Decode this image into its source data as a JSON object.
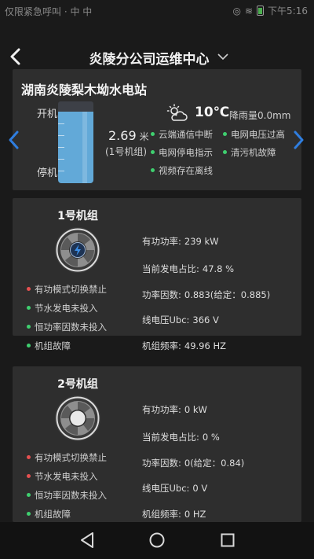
{
  "statusbar": {
    "carrier": "仅限紧急呼叫 · 中 中",
    "time": "下午5:16"
  },
  "header": {
    "title": "炎陵分公司运维中心"
  },
  "station": {
    "name": "湖南炎陵梨木坳水电站",
    "label_on": "开机",
    "label_off": "停机",
    "level_value": "2.69",
    "level_unit": "米",
    "level_unitname": "(1号机组)",
    "water_fill_fraction": 1.0,
    "temperature": "10℃",
    "rainfall": "降雨量0.0mm",
    "alarms": [
      {
        "text": "云端通信中断",
        "status": "green"
      },
      {
        "text": "电网电压过高",
        "status": "green"
      },
      {
        "text": "电网停电指示",
        "status": "green"
      },
      {
        "text": "清污机故障",
        "status": "green"
      },
      {
        "text": "视频存在离线",
        "status": "green"
      }
    ]
  },
  "units": [
    {
      "title": "1号机组",
      "icon": "turbine-running-icon",
      "alarms": [
        {
          "text": "有功模式切换禁止",
          "status": "red"
        },
        {
          "text": "节水发电未投入",
          "status": "green"
        },
        {
          "text": "恒功率因数未投入",
          "status": "green"
        },
        {
          "text": "机组故障",
          "status": "green"
        }
      ],
      "metrics": [
        {
          "label": "有功功率:",
          "value": "239 kW"
        },
        {
          "label": "当前发电占比:",
          "value": "47.8 %"
        },
        {
          "label": "功率因数:",
          "value": "0.883(给定：0.885)"
        },
        {
          "label": "线电压Ubc:",
          "value": "366 V"
        },
        {
          "label": "机组频率:",
          "value": "49.96 HZ"
        }
      ]
    },
    {
      "title": "2号机组",
      "icon": "turbine-stopped-icon",
      "alarms": [
        {
          "text": "有功模式切换禁止",
          "status": "red"
        },
        {
          "text": "节水发电未投入",
          "status": "red"
        },
        {
          "text": "恒功率因数未投入",
          "status": "green"
        },
        {
          "text": "机组故障",
          "status": "green"
        }
      ],
      "metrics": [
        {
          "label": "有功功率:",
          "value": "0 kW"
        },
        {
          "label": "当前发电占比:",
          "value": "0 %"
        },
        {
          "label": "功率因数:",
          "value": "0(给定：0.84)"
        },
        {
          "label": "线电压Ubc:",
          "value": "0 V"
        },
        {
          "label": "机组频率:",
          "value": "0 HZ"
        }
      ]
    }
  ],
  "colors": {
    "background": "#1a1a1a",
    "card": "#2e2e2e",
    "ok": "#3fcf6f",
    "alarm": "#e55050",
    "accent": "#2f7ee0",
    "water": "#62a9d8"
  }
}
